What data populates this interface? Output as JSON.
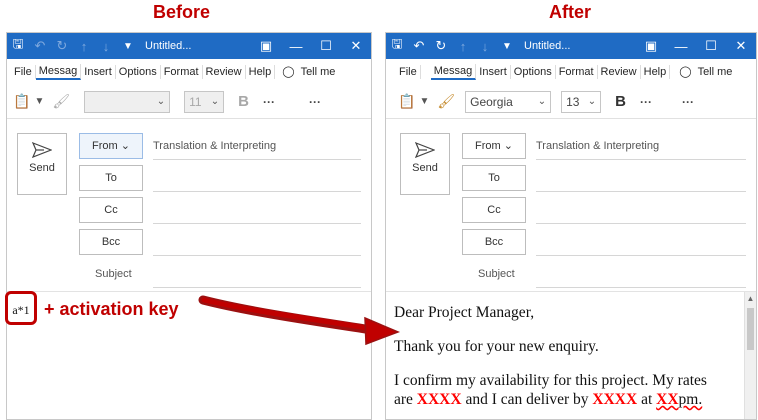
{
  "captions": {
    "before": "Before",
    "after": "After"
  },
  "colors": {
    "titlebar": "#1f6bc4",
    "caption": "#c00000",
    "placeholder": "#ff0000"
  },
  "window": {
    "title": "Untitled..."
  },
  "menu": [
    "File",
    "Messag",
    "Insert",
    "Options",
    "Format",
    "Review",
    "Help"
  ],
  "menu_tell": "Tell me",
  "toolbar": {
    "font_before": "",
    "size_before": "11",
    "font_after": "Georgia",
    "size_after": "13",
    "bold": "B",
    "more": "···"
  },
  "form": {
    "send": "Send",
    "from": "From",
    "from_value": "Translation & Interpreting",
    "to": "To",
    "cc": "Cc",
    "bcc": "Bcc",
    "subject": "Subject"
  },
  "before_body": {
    "typed": "a*1",
    "annotation": "+ activation key"
  },
  "after_body": {
    "greeting": "Dear Project Manager,",
    "thanks": "Thank you for your new enquiry.",
    "l3a": "I confirm my availability for this project. My rates",
    "l3b": "are ",
    "rate": "XXXX",
    "l3c": " and I can deliver by ",
    "date": "XXXX",
    "l3d": " at ",
    "time": "XX",
    "l3e": "pm."
  }
}
